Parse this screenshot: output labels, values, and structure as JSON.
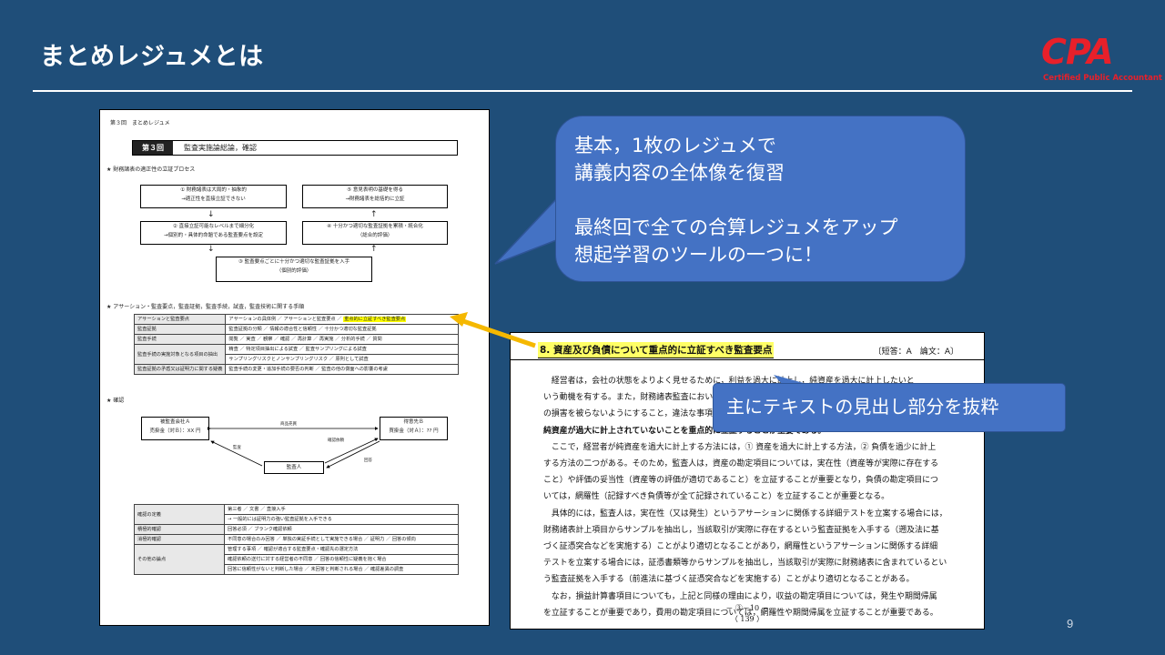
{
  "slide": {
    "title": "まとめレジュメとは",
    "page_number": "9",
    "logo": {
      "text": "CPA",
      "subtitle": "Certified Public Accountant"
    }
  },
  "callout_main": {
    "lines": [
      "基本，1枚のレジュメで",
      "講義内容の全体像を復習",
      "",
      "最終回で全ての合算レジュメをアップ",
      "想起学習のツールの一つに！"
    ]
  },
  "callout_heading": {
    "text": "主にテキストの見出し部分を抜粋"
  },
  "colors": {
    "background": "#1f4e79",
    "callout": "#4472c4",
    "arrow": "#f5b800",
    "highlight": "#ffff00",
    "logo": "#e8202a"
  },
  "left_doc": {
    "header": "第３回　まとめレジュメ",
    "banner_num": "第３回",
    "banner_text": "監査実施論総論，確認",
    "section1": "★ 財務諸表の適正性の立証プロセス",
    "boxes": {
      "b1": [
        "① 財務諸表は大局的・抽象的",
        "→適正性を直接立証できない"
      ],
      "b5": [
        "⑤ 意見表明の基礎を得る",
        "→財務諸表を総括的に立証"
      ],
      "b2": [
        "② 直接立証可能なレベルまで細分化",
        "→個別的・具体的命題である監査要点を設定"
      ],
      "b4": [
        "④ 十分かつ適切な監査証拠を累積・統合化",
        "（総合的評価）"
      ],
      "b3": [
        "③ 監査要点ごとに十分かつ適切な監査証拠を入手",
        "（個別的評価）"
      ]
    },
    "section2": "★ アサーション・監査要点，監査証拠，監査手続，試査，監査技術に関する手順",
    "table1": [
      {
        "h": "アサーションと監査要点",
        "v": "アサーションの具体例 ／ アサーションと監査要点 ／ ",
        "hl": "重点的に立証すべき監査要点"
      },
      {
        "h": "監査証拠",
        "v": "監査証拠の分類 ／ 情報の適合性と信頼性 ／ 十分かつ適切な監査証拠",
        "hl": ""
      },
      {
        "h": "監査手続",
        "v": "閲覧 ／ 実査 ／ 観察 ／ 確認 ／ 再計算 ／ 再実施 ／ 分析的手続 ／ 質問",
        "hl": ""
      },
      {
        "h": "監査手続の実施対象となる項目の抽出",
        "v": "精査 ／ 特定項目抽出による試査 ／ 監査サンプリングによる試査",
        "hl": ""
      },
      {
        "h": "",
        "v": "サンプリングリスクとノンサンプリングリスク ／ 原則として試査",
        "hl": ""
      },
      {
        "h": "監査証拠の矛盾又は証明力に関する疑義",
        "v": "監査手続の変更・追加手続の要否の判断 ／ 監査の他の側面への影響の考慮",
        "hl": ""
      }
    ],
    "section3": "★ 確認",
    "confirm": {
      "company_a": "被監査会社Ａ",
      "company_a_sub": "売掛金（対Ｂ）：XX 円",
      "party_b": "得意先Ｂ",
      "party_b_sub": "買掛金（対Ａ）：?? 円",
      "auditor": "監査人",
      "top_arrow": "商品売買",
      "left_arrow": "監査",
      "mid_arrow": "確認依頼",
      "right_arrow": "回答"
    },
    "table2": [
      {
        "h": "確認の定義",
        "v": "第三者 ／ 文書 ／ 直接入手"
      },
      {
        "h": "",
        "v": "→ 一般的には証明力の強い監査証拠を入手できる"
      },
      {
        "h": "積極的確認",
        "v": "回答必須 ／ ブランク確認依頼"
      },
      {
        "h": "消極的確認",
        "v": "不同意の場合のみ回答 ／ 単独の実証手続として実施できる場合 ／ 証明力 ／ 回答の傾向"
      },
      {
        "h": "その他の論点",
        "v": "管理する事項 ／ 確認が適合する監査要点・確認先の選定方法"
      },
      {
        "h": "",
        "v": "確認依頼の送付に対する経営者の不同意 ／ 回答の信頼性に疑義を抱く場合"
      },
      {
        "h": "",
        "v": "回答に信頼性がないと判断した場合 ／ 未回答と判断される場合 ／ 確認差異の調査"
      }
    ]
  },
  "right_doc": {
    "heading": "8. 資産及び負債について重点的に立証すべき監査要点",
    "tag": "〔短答：A　論文：A〕",
    "paragraphs": [
      "　経営者は，会社の状態をよりよく見せるために，利益を過大に計上し，純資産を過大に計上したいと",
      "いう動機を有する。また，財務諸表監査において，監査人は財務諸表利用者を保護する立場から，財務諸表利用者",
      "の損害を被らないようにすること，違法な事項を発見するという観点から，監査人は，",
      "純資産が過大に計上されていないことを重点的に立証することが重要である。",
      "　ここで，経営者が純資産を過大に計上する方法には，① 資産を過大に計上する方法，② 負債を過少に計上",
      "する方法の二つがある。そのため，監査人は，資産の勘定項目については，実在性（資産等が実際に存在する",
      "こと）や評価の妥当性（資産等の評価が適切であること）を立証することが重要となり，負債の勘定項目につ",
      "いては，網羅性（記録すべき負債等が全て記録されていること）を立証することが重要となる。",
      "　具体的には，監査人は，実在性（又は発生）というアサーションに関係する詳細テストを立案する場合には，",
      "財務諸表計上項目からサンプルを抽出し，当該取引が実際に存在するという監査証拠を入手する（遡及法に基",
      "づく証憑突合などを実施する）ことがより適切となることがあり，網羅性というアサーションに関係する詳細",
      "テストを立案する場合には，証憑書類等からサンプルを抽出し，当該取引が実際に財務諸表に含まれているとい",
      "う監査証拠を入手する（前進法に基づく証憑突合などを実施する）ことがより適切となることがある。",
      "　なお，損益計算書項目についても，上記と同様の理由により，収益の勘定項目については，発生や期間帰属",
      "を立証することが重要であり，費用の勘定項目については，網羅性や期間帰属を立証することが重要である。"
    ],
    "page_a": "－ ③－10 －",
    "page_b": "（ 139 ）"
  }
}
